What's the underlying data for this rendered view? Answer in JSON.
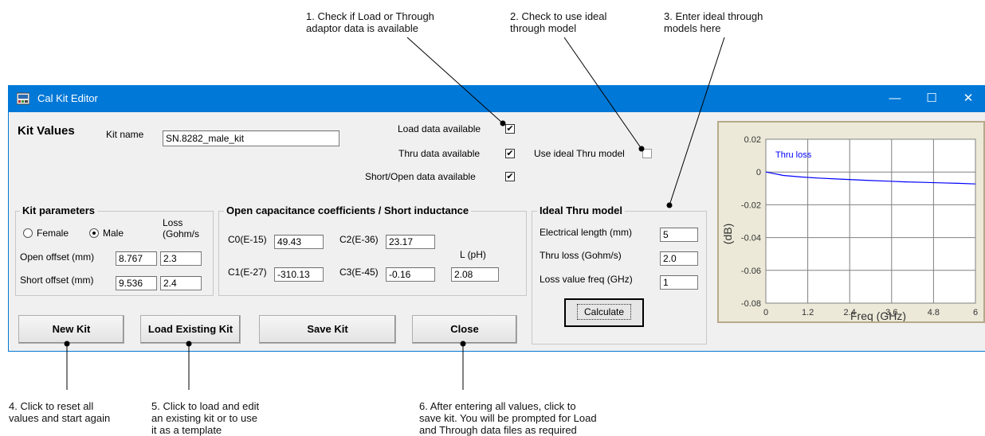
{
  "annotations": {
    "c1": "1. Check if Load or Through\nadaptor data is available",
    "c2": "2. Check to use ideal\nthrough model",
    "c3": "3. Enter ideal through\nmodels here",
    "c4": "4. Click to reset all\nvalues and start again",
    "c5": "5. Click to load and edit\nan existing kit or to use\nit as a template",
    "c6": "6. After entering all values, click to\nsave kit. You will be prompted for Load\nand Through data files as required"
  },
  "window": {
    "title": "Cal Kit Editor",
    "minimize": "—",
    "maximize": "☐",
    "close": "✕"
  },
  "kit": {
    "heading": "Kit Values",
    "name_label": "Kit name",
    "name_value": "SN.8282_male_kit"
  },
  "availability": {
    "load_label": "Load data available",
    "load_checked": "✔",
    "thru_label": "Thru data available",
    "thru_checked": "✔",
    "shortopen_label": "Short/Open data available",
    "shortopen_checked": "✔",
    "ideal_thru_label": "Use ideal Thru model"
  },
  "kit_parameters": {
    "title": "Kit parameters",
    "female_label": "Female",
    "male_label": "Male",
    "loss_header": "Loss\n(Gohm/s",
    "open_offset_label": "Open offset (mm)",
    "open_offset_value": "8.767",
    "open_loss_value": "2.3",
    "short_offset_label": "Short offset (mm)",
    "short_offset_value": "9.536",
    "short_loss_value": "2.4"
  },
  "coefficients": {
    "title": "Open capacitance coefficients / Short inductance",
    "c0_label": "C0(E-15)",
    "c0_value": "49.43",
    "c1_label": "C1(E-27)",
    "c1_value": "-310.13",
    "c2_label": "C2(E-36)",
    "c2_value": "23.17",
    "c3_label": "C3(E-45)",
    "c3_value": "-0.16",
    "l_label": "L (pH)",
    "l_value": "2.08"
  },
  "ideal_thru": {
    "title": "Ideal Thru model",
    "elec_length_label": "Electrical length (mm)",
    "elec_length_value": "5",
    "thru_loss_label": "Thru loss (Gohm/s)",
    "thru_loss_value": "2.0",
    "loss_freq_label": "Loss value freq (GHz)",
    "loss_freq_value": "1",
    "calculate_label": "Calculate"
  },
  "buttons": {
    "new_kit": "New Kit",
    "load_existing": "Load Existing Kit",
    "save_kit": "Save Kit",
    "close": "Close"
  },
  "chart_data": {
    "type": "line",
    "xlabel": "Freq (GHz)",
    "ylabel": "(dB)",
    "xlim": [
      0,
      6
    ],
    "ylim": [
      -0.08,
      0.02
    ],
    "x_ticks": [
      "0",
      "1.2",
      "2.4",
      "3.6",
      "4.8",
      "6"
    ],
    "y_ticks": [
      "0.02",
      "0",
      "-0.02",
      "-0.04",
      "-0.06",
      "-0.08"
    ],
    "grid": true,
    "series": [
      {
        "name": "Thru loss",
        "color": "#0000ff",
        "x": [
          0,
          0.5,
          1,
          1.5,
          2,
          2.5,
          3,
          3.5,
          4,
          4.5,
          5,
          5.5,
          6
        ],
        "y": [
          0,
          -0.0021,
          -0.003,
          -0.0037,
          -0.0042,
          -0.0047,
          -0.0052,
          -0.0056,
          -0.006,
          -0.0063,
          -0.0066,
          -0.0069,
          -0.0073
        ]
      }
    ]
  },
  "colors": {
    "titlebar": "#0078d7",
    "plot_background": "#ece9d8",
    "series": "#0000ff"
  }
}
